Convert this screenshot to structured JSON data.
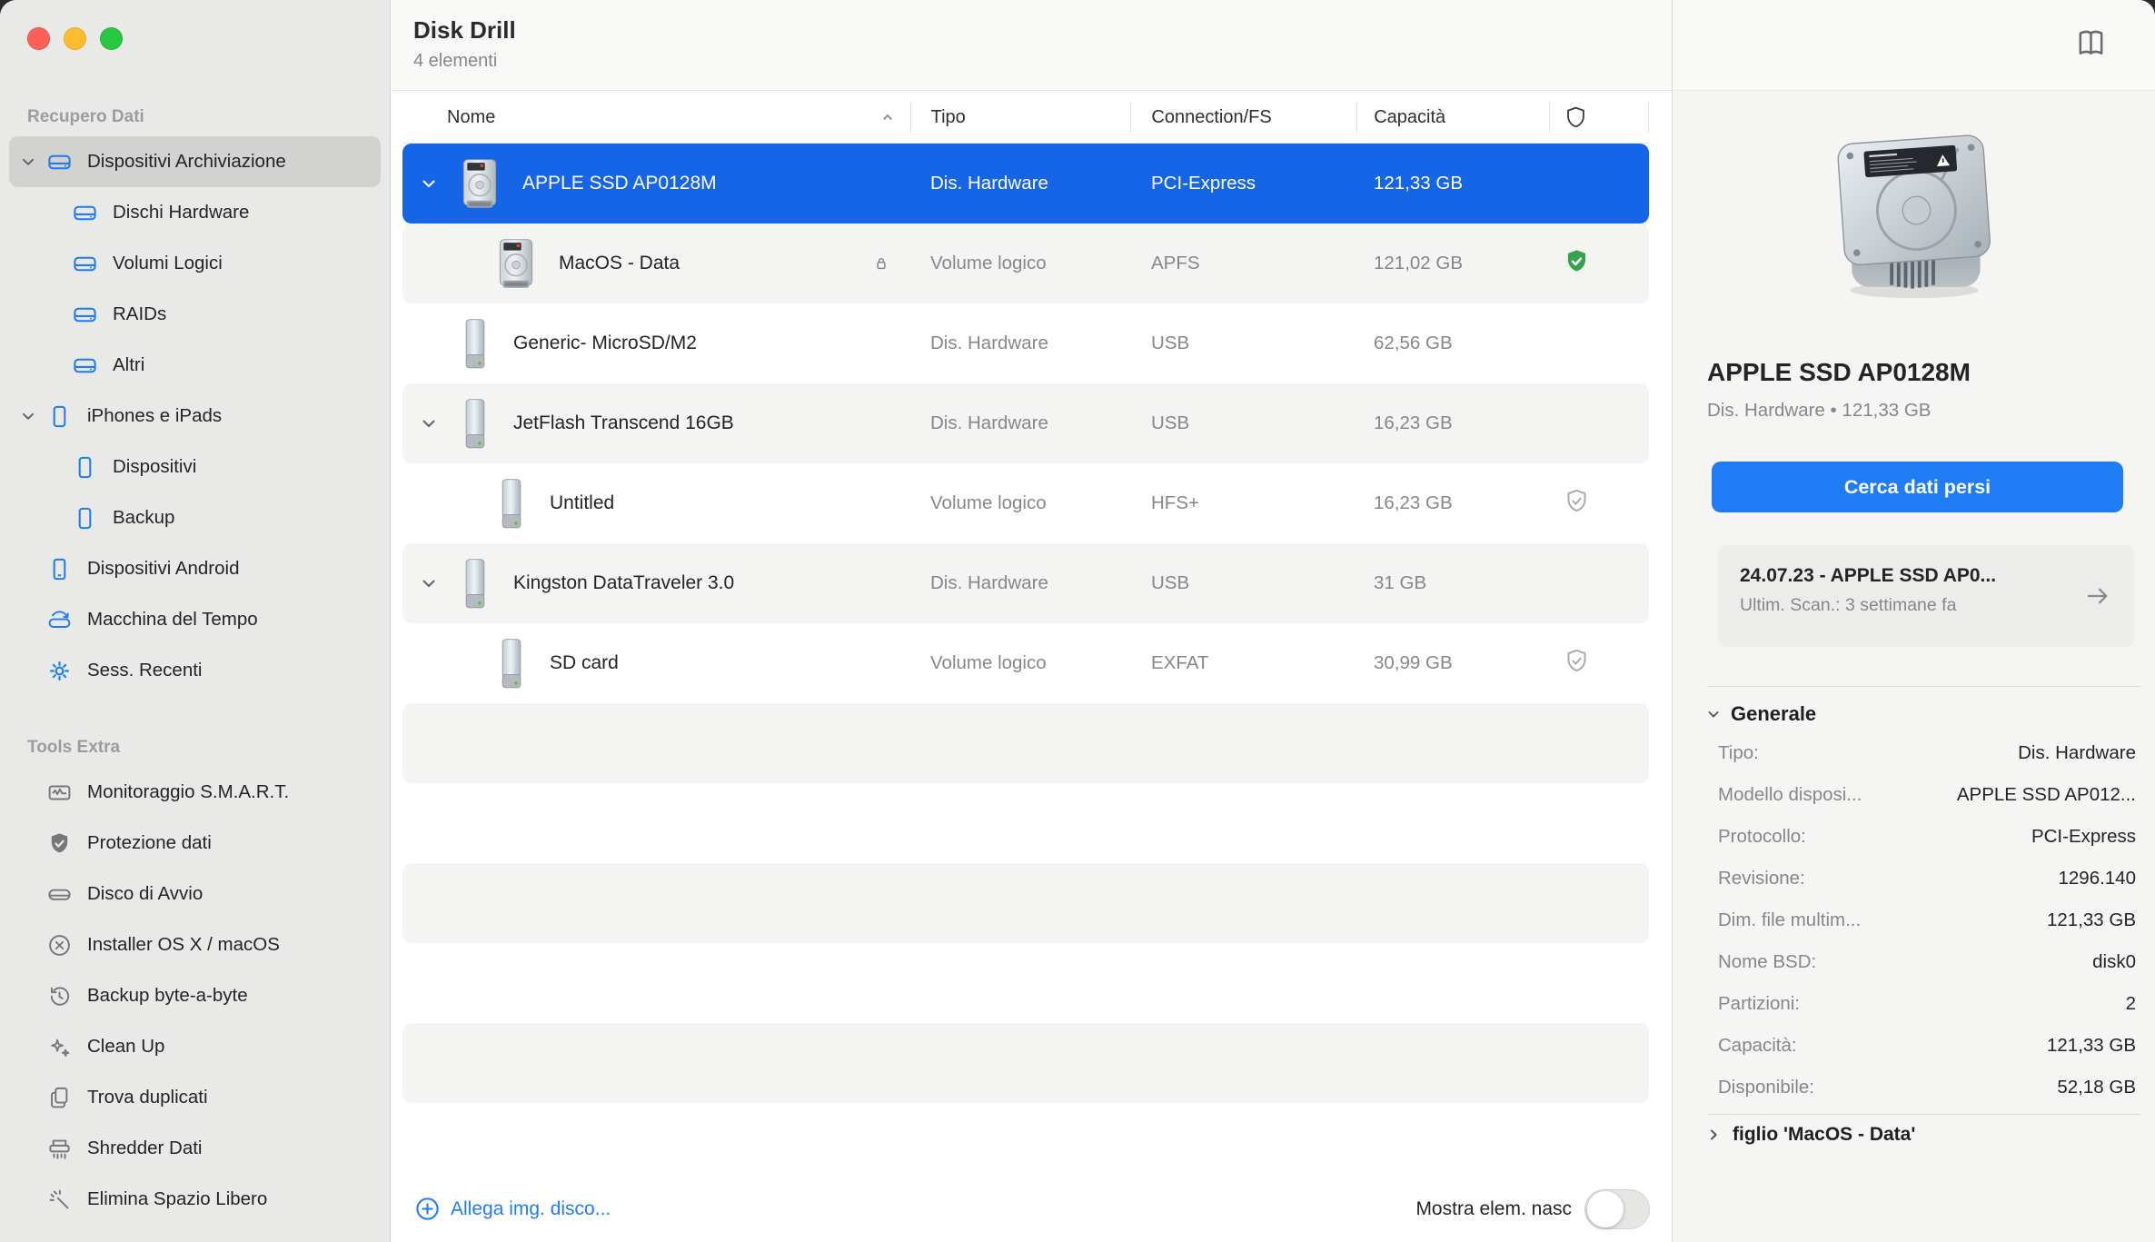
{
  "window": {
    "title": "Disk Drill",
    "subtitle": "4 elementi"
  },
  "colors": {
    "accent_blue": "#1f7bf4",
    "selection_blue": "#1565e6",
    "shield_green": "#35a24c"
  },
  "sidebar": {
    "sections": [
      {
        "label": "Recupero Dati",
        "items": [
          {
            "label": "Dispositivi Archiviazione",
            "icon": "storage-drive",
            "tone": "blue",
            "chevron": "down",
            "selected": true,
            "level": 0
          },
          {
            "label": "Dischi Hardware",
            "icon": "storage-drive",
            "tone": "blue",
            "level": 1
          },
          {
            "label": "Volumi Logici",
            "icon": "storage-drive",
            "tone": "blue",
            "level": 1
          },
          {
            "label": "RAIDs",
            "icon": "storage-drive",
            "tone": "blue",
            "level": 1
          },
          {
            "label": "Altri",
            "icon": "storage-drive",
            "tone": "blue",
            "level": 1
          },
          {
            "label": "iPhones e iPads",
            "icon": "iphone",
            "tone": "blue",
            "chevron": "down",
            "level": 0
          },
          {
            "label": "Dispositivi",
            "icon": "iphone",
            "tone": "blue",
            "level": 1
          },
          {
            "label": "Backup",
            "icon": "iphone",
            "tone": "blue",
            "level": 1
          },
          {
            "label": "Dispositivi Android",
            "icon": "android-phone",
            "tone": "blue",
            "level": 0
          },
          {
            "label": "Macchina del Tempo",
            "icon": "time-machine",
            "tone": "blue",
            "level": 0
          },
          {
            "label": "Sess. Recenti",
            "icon": "gear",
            "tone": "blue",
            "level": 0
          }
        ]
      },
      {
        "label": "Tools Extra",
        "items": [
          {
            "label": "Monitoraggio S.M.A.R.T.",
            "icon": "smart-monitor",
            "tone": "gray",
            "level": 0
          },
          {
            "label": "Protezione dati",
            "icon": "shield-check-filled",
            "tone": "gray",
            "level": 0
          },
          {
            "label": "Disco di Avvio",
            "icon": "boot-disk",
            "tone": "gray",
            "level": 0
          },
          {
            "label": "Installer OS X / macOS",
            "icon": "circle-x",
            "tone": "gray",
            "level": 0
          },
          {
            "label": "Backup byte-a-byte",
            "icon": "history-clock",
            "tone": "gray",
            "level": 0
          },
          {
            "label": "Clean Up",
            "icon": "sparkle",
            "tone": "gray",
            "level": 0
          },
          {
            "label": "Trova duplicati",
            "icon": "duplicate-files",
            "tone": "gray",
            "level": 0
          },
          {
            "label": "Shredder Dati",
            "icon": "shredder",
            "tone": "gray",
            "level": 0
          },
          {
            "label": "Elimina Spazio Libero",
            "icon": "erase-free-space",
            "tone": "gray",
            "level": 0
          }
        ]
      }
    ]
  },
  "table": {
    "columns": [
      {
        "label": "Nome",
        "sort": "asc"
      },
      {
        "label": "Tipo"
      },
      {
        "label": "Connection/FS"
      },
      {
        "label": "Capacità"
      },
      {
        "label": "",
        "icon": "shield-outline"
      }
    ],
    "rows": [
      {
        "name": "APPLE SSD AP0128M",
        "type": "Dis. Hardware",
        "connection": "PCI-Express",
        "capacity": "121,33 GB",
        "icon": "hdd",
        "chevron": "down",
        "level": 0,
        "selected": true
      },
      {
        "name": "MacOS - Data",
        "type": "Volume logico",
        "connection": "APFS",
        "capacity": "121,02 GB",
        "icon": "hdd",
        "level": 1,
        "lock": true,
        "shield": "green"
      },
      {
        "name": "Generic- MicroSD/M2",
        "type": "Dis. Hardware",
        "connection": "USB",
        "capacity": "62,56 GB",
        "icon": "usb",
        "level": 0
      },
      {
        "name": "JetFlash Transcend 16GB",
        "type": "Dis. Hardware",
        "connection": "USB",
        "capacity": "16,23 GB",
        "icon": "usb",
        "chevron": "down",
        "level": 0
      },
      {
        "name": "Untitled",
        "type": "Volume logico",
        "connection": "HFS+",
        "capacity": "16,23 GB",
        "icon": "usb",
        "level": 1,
        "shield": "outline"
      },
      {
        "name": "Kingston DataTraveler 3.0",
        "type": "Dis. Hardware",
        "connection": "USB",
        "capacity": "31 GB",
        "icon": "usb",
        "chevron": "down",
        "level": 0
      },
      {
        "name": "SD card",
        "type": "Volume logico",
        "connection": "EXFAT",
        "capacity": "30,99 GB",
        "icon": "usb",
        "level": 1,
        "shield": "outline"
      }
    ],
    "empty_rows": 5
  },
  "footer": {
    "attach_link": "Allega img. disco...",
    "show_hidden_label": "Mostra elem. nasc",
    "toggle_state": "off"
  },
  "inspector": {
    "title": "APPLE SSD AP0128M",
    "subtitle": "Dis. Hardware • 121,33 GB",
    "scan_button": "Cerca dati persi",
    "last_scan": {
      "title": "24.07.23 - APPLE SSD AP0...",
      "subtitle": "Ultim. Scan.: 3 settimane fa"
    },
    "general": {
      "header": "Generale",
      "rows": [
        {
          "label": "Tipo:",
          "value": "Dis. Hardware"
        },
        {
          "label": "Modello disposi...",
          "value": "APPLE SSD AP012..."
        },
        {
          "label": "Protocollo:",
          "value": "PCI-Express"
        },
        {
          "label": "Revisione:",
          "value": "1296.140"
        },
        {
          "label": "Dim. file multim...",
          "value": "121,33 GB"
        },
        {
          "label": "Nome BSD:",
          "value": "disk0"
        },
        {
          "label": "Partizioni:",
          "value": "2"
        },
        {
          "label": "Capacità:",
          "value": "121,33 GB"
        },
        {
          "label": "Disponibile:",
          "value": "52,18 GB"
        }
      ]
    },
    "child_link": "figlio 'MacOS - Data'"
  }
}
